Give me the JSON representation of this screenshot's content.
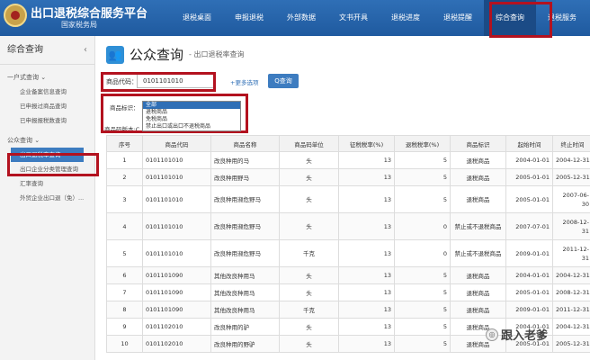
{
  "header": {
    "title": "出口退税综合服务平台",
    "subtitle": "国家税务局",
    "nav": [
      "退税桌面",
      "申报退税",
      "外部数据",
      "文书开具",
      "退税进度",
      "退税提醒",
      "综合查询",
      "退税服务"
    ]
  },
  "sidebar": {
    "title": "综合查询",
    "groups": [
      {
        "label": "一户式查询 ⌄",
        "items": [
          "企业备案信息查询",
          "已申报过商品查询",
          "已申报报税数查询"
        ]
      },
      {
        "label": "公众查询 ⌄",
        "items": [
          "出口退税率查询",
          "出口企业分类管理查询",
          "汇率查询",
          "外贸企业出口退（免）..."
        ]
      }
    ]
  },
  "page": {
    "title": "公众查询",
    "subtitle": "- 出口退税率查询",
    "code_label": "商品代码：",
    "code_value": "0101101010",
    "more_link": "+更多选项",
    "query_button": "Q查询",
    "mark_label": "商品标识：",
    "mark_options": [
      "全部",
      "退税商品",
      "免税商品",
      "禁止出口或出口不退税商品"
    ],
    "version_label": "商品码版本:C"
  },
  "table": {
    "headers": [
      "序号",
      "商品代码",
      "商品名称",
      "商品码单位",
      "征税税率(%)",
      "退税税率(%)",
      "商品标识",
      "起始时间",
      "终止时间"
    ],
    "rows": [
      [
        "1",
        "0101101010",
        "改良种用的马",
        "头",
        "13",
        "5",
        "退税商品",
        "2004-01-01",
        "2004-12-31"
      ],
      [
        "2",
        "0101101010",
        "改良种用野马",
        "头",
        "13",
        "5",
        "退税商品",
        "2005-01-01",
        "2005-12-31"
      ],
      [
        "3",
        "0101101010",
        "改良种用濒危野马",
        "头",
        "13",
        "5",
        "退税商品",
        "2005-01-01",
        "2007-06-30"
      ],
      [
        "4",
        "0101101010",
        "改良种用濒危野马",
        "头",
        "13",
        "0",
        "禁止或不退税商品",
        "2007-07-01",
        "2008-12-31"
      ],
      [
        "5",
        "0101101010",
        "改良种用濒危野马",
        "千克",
        "13",
        "0",
        "禁止或不退税商品",
        "2009-01-01",
        "2011-12-31"
      ],
      [
        "6",
        "0101101090",
        "其他改良种用马",
        "头",
        "13",
        "5",
        "退税商品",
        "2004-01-01",
        "2004-12-31"
      ],
      [
        "7",
        "0101101090",
        "其他改良种用马",
        "头",
        "13",
        "5",
        "退税商品",
        "2005-01-01",
        "2008-12-31"
      ],
      [
        "8",
        "0101101090",
        "其他改良种用马",
        "千克",
        "13",
        "5",
        "退税商品",
        "2009-01-01",
        "2011-12-31"
      ],
      [
        "9",
        "0101102010",
        "改良种用的驴",
        "头",
        "13",
        "5",
        "退税商品",
        "2004-01-01",
        "2004-12-31"
      ],
      [
        "10",
        "0101102010",
        "改良种用的野驴",
        "头",
        "13",
        "5",
        "退税商品",
        "2005-01-01",
        "2005-12-31"
      ]
    ]
  },
  "watermark": "跟入老爹"
}
